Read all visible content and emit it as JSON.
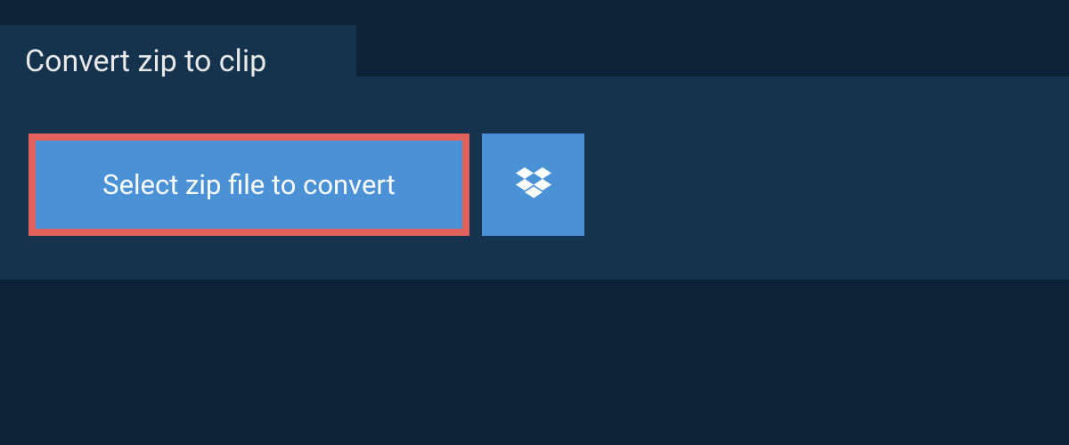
{
  "tab": {
    "label": "Convert zip to clip"
  },
  "actions": {
    "select_file_label": "Select zip file to convert"
  },
  "colors": {
    "page_bg": "#0d2438",
    "panel_bg": "#15334d",
    "button_bg": "#4b91d6",
    "button_border_highlight": "#e0625a",
    "text_light": "#e8e8e8",
    "text_white": "#ffffff"
  }
}
